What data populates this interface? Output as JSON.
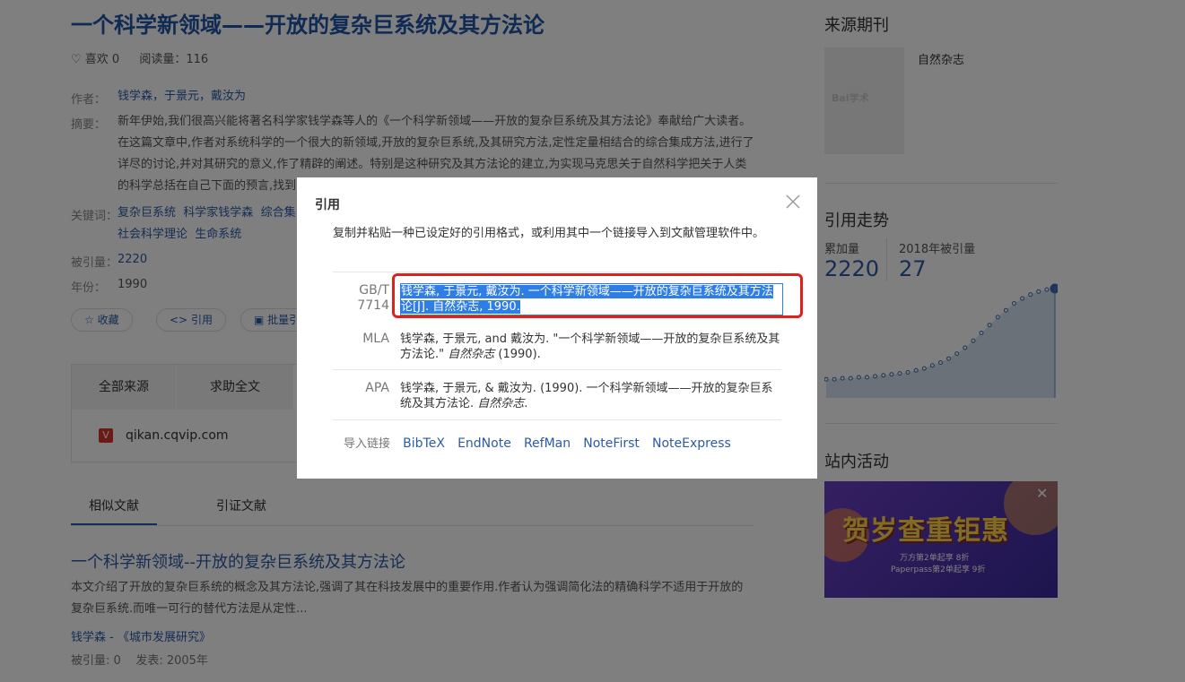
{
  "article": {
    "title": "一个科学新领域——开放的复杂巨系统及其方法论",
    "likes": "♡ 喜欢 0",
    "reads": "阅读量：116",
    "author_label": "作者：",
    "authors": "钱学森，于景元，戴汝为",
    "abstract_label": "摘要：",
    "abstract": "新年伊始,我们很高兴能将著名科学家钱学森等人的《一个科学新领域——开放的复杂巨系统及其方法论》奉献给广大读者。在这篇文章中,作者对系统科学的一个很大的新领域,开放的复杂巨系统,及其研究方法,定性定量相结合的综合集成方法,进行了详尽的讨论,并对其研究的意义,作了精辟的阐述。特别是这种研究及其方法论的建立,为实现马克思关于自然科学把关于人类的科学总括在自己下面的预言,找到",
    "keywords_label": "关键词：",
    "keywords": [
      "复杂巨系统",
      "科学家钱学森",
      "综合集",
      "社会科学理论",
      "生命系统"
    ],
    "cited_label": "被引量：",
    "cited": "2220",
    "year_label": "年份：",
    "year": "1990",
    "buttons": {
      "collect": "收藏",
      "cite": "引用",
      "batch": "批量引"
    }
  },
  "source_tabs": {
    "all": "全部来源",
    "help": "求助全文",
    "source_site": "qikan.cqvip.com"
  },
  "related_tabs": {
    "similar": "相似文献",
    "citing": "引证文献"
  },
  "similar": {
    "title": "一个科学新领域--开放的复杂巨系统及其方法论",
    "abstract": "本文介绍了开放的复杂巨系统的概念及其方法论,强调了其在科技发展中的重要作用.作者认为强调简化法的精确科学不适用于开放的复杂巨系统.而唯一可行的替代方法是从定性...",
    "author_journal": "钱学森 - 《城市发展研究》",
    "cited": "被引量: 0",
    "published": "发表: 2005年"
  },
  "sidebar": {
    "journal_heading": "来源期刊",
    "journal_name": "自然杂志",
    "journal_logo_text": "Bai学术",
    "trend_heading": "引用走势",
    "total_label": "累加量",
    "total_value": "2220",
    "year_label": "2018年被引量",
    "year_value": "27",
    "activity_heading": "站内活动",
    "banner_title": "贺岁查重钜惠",
    "banner_line1": "万方第2单起享 8折",
    "banner_line2": "Paperpass第2单起享 9折",
    "trend_points": [
      8,
      8,
      9,
      9,
      10,
      10,
      11,
      12,
      13,
      14,
      15,
      17,
      19,
      22,
      25,
      29,
      34,
      40,
      47,
      55,
      63,
      71,
      78,
      85,
      90,
      94,
      97,
      99,
      100
    ]
  },
  "modal": {
    "title": "引用",
    "description": "复制并粘贴一种已设定好的引用格式，或利用其中一个链接导入到文献管理软件中。",
    "gbt_label": "GB/T 7714",
    "gbt_text": "钱学森, 于景元, 戴汝为. 一个科学新领域——开放的复杂巨系统及其方法论[J]. 自然杂志, 1990.",
    "mla_label": "MLA",
    "mla_text": "钱学森, 于景元, and 戴汝为. \"一个科学新领域——开放的复杂巨系统及其方法论.\"",
    "mla_journal": "自然杂志",
    "mla_tail": " (1990).",
    "apa_label": "APA",
    "apa_text": "钱学森, 于景元, & 戴汝为. (1990). 一个科学新领域——开放的复杂巨系统及其方法论.",
    "apa_journal": "自然杂志",
    "apa_tail": ".",
    "import_label": "导入链接",
    "import_links": [
      "BibTeX",
      "EndNote",
      "RefMan",
      "NoteFirst",
      "NoteExpress"
    ]
  },
  "colors": {
    "title_blue": "#1f55a6",
    "link_blue": "#2b5ba8",
    "highlight_red": "#e0201a",
    "selection": "#2f7ee6"
  }
}
